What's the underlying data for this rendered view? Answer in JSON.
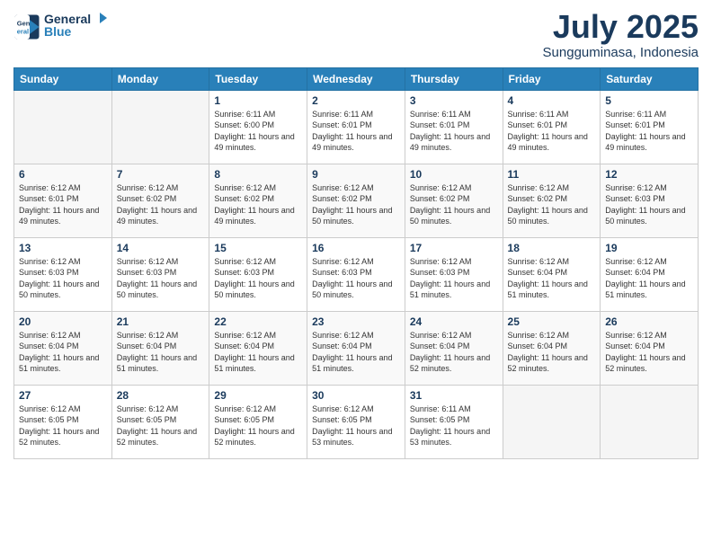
{
  "header": {
    "logo_line1": "General",
    "logo_line2": "Blue",
    "month": "July 2025",
    "location": "Sungguminasa, Indonesia"
  },
  "days_of_week": [
    "Sunday",
    "Monday",
    "Tuesday",
    "Wednesday",
    "Thursday",
    "Friday",
    "Saturday"
  ],
  "weeks": [
    [
      {
        "day": "",
        "info": ""
      },
      {
        "day": "",
        "info": ""
      },
      {
        "day": "1",
        "info": "Sunrise: 6:11 AM\nSunset: 6:00 PM\nDaylight: 11 hours\nand 49 minutes."
      },
      {
        "day": "2",
        "info": "Sunrise: 6:11 AM\nSunset: 6:01 PM\nDaylight: 11 hours\nand 49 minutes."
      },
      {
        "day": "3",
        "info": "Sunrise: 6:11 AM\nSunset: 6:01 PM\nDaylight: 11 hours\nand 49 minutes."
      },
      {
        "day": "4",
        "info": "Sunrise: 6:11 AM\nSunset: 6:01 PM\nDaylight: 11 hours\nand 49 minutes."
      },
      {
        "day": "5",
        "info": "Sunrise: 6:11 AM\nSunset: 6:01 PM\nDaylight: 11 hours\nand 49 minutes."
      }
    ],
    [
      {
        "day": "6",
        "info": "Sunrise: 6:12 AM\nSunset: 6:01 PM\nDaylight: 11 hours\nand 49 minutes."
      },
      {
        "day": "7",
        "info": "Sunrise: 6:12 AM\nSunset: 6:02 PM\nDaylight: 11 hours\nand 49 minutes."
      },
      {
        "day": "8",
        "info": "Sunrise: 6:12 AM\nSunset: 6:02 PM\nDaylight: 11 hours\nand 49 minutes."
      },
      {
        "day": "9",
        "info": "Sunrise: 6:12 AM\nSunset: 6:02 PM\nDaylight: 11 hours\nand 50 minutes."
      },
      {
        "day": "10",
        "info": "Sunrise: 6:12 AM\nSunset: 6:02 PM\nDaylight: 11 hours\nand 50 minutes."
      },
      {
        "day": "11",
        "info": "Sunrise: 6:12 AM\nSunset: 6:02 PM\nDaylight: 11 hours\nand 50 minutes."
      },
      {
        "day": "12",
        "info": "Sunrise: 6:12 AM\nSunset: 6:03 PM\nDaylight: 11 hours\nand 50 minutes."
      }
    ],
    [
      {
        "day": "13",
        "info": "Sunrise: 6:12 AM\nSunset: 6:03 PM\nDaylight: 11 hours\nand 50 minutes."
      },
      {
        "day": "14",
        "info": "Sunrise: 6:12 AM\nSunset: 6:03 PM\nDaylight: 11 hours\nand 50 minutes."
      },
      {
        "day": "15",
        "info": "Sunrise: 6:12 AM\nSunset: 6:03 PM\nDaylight: 11 hours\nand 50 minutes."
      },
      {
        "day": "16",
        "info": "Sunrise: 6:12 AM\nSunset: 6:03 PM\nDaylight: 11 hours\nand 50 minutes."
      },
      {
        "day": "17",
        "info": "Sunrise: 6:12 AM\nSunset: 6:03 PM\nDaylight: 11 hours\nand 51 minutes."
      },
      {
        "day": "18",
        "info": "Sunrise: 6:12 AM\nSunset: 6:04 PM\nDaylight: 11 hours\nand 51 minutes."
      },
      {
        "day": "19",
        "info": "Sunrise: 6:12 AM\nSunset: 6:04 PM\nDaylight: 11 hours\nand 51 minutes."
      }
    ],
    [
      {
        "day": "20",
        "info": "Sunrise: 6:12 AM\nSunset: 6:04 PM\nDaylight: 11 hours\nand 51 minutes."
      },
      {
        "day": "21",
        "info": "Sunrise: 6:12 AM\nSunset: 6:04 PM\nDaylight: 11 hours\nand 51 minutes."
      },
      {
        "day": "22",
        "info": "Sunrise: 6:12 AM\nSunset: 6:04 PM\nDaylight: 11 hours\nand 51 minutes."
      },
      {
        "day": "23",
        "info": "Sunrise: 6:12 AM\nSunset: 6:04 PM\nDaylight: 11 hours\nand 51 minutes."
      },
      {
        "day": "24",
        "info": "Sunrise: 6:12 AM\nSunset: 6:04 PM\nDaylight: 11 hours\nand 52 minutes."
      },
      {
        "day": "25",
        "info": "Sunrise: 6:12 AM\nSunset: 6:04 PM\nDaylight: 11 hours\nand 52 minutes."
      },
      {
        "day": "26",
        "info": "Sunrise: 6:12 AM\nSunset: 6:04 PM\nDaylight: 11 hours\nand 52 minutes."
      }
    ],
    [
      {
        "day": "27",
        "info": "Sunrise: 6:12 AM\nSunset: 6:05 PM\nDaylight: 11 hours\nand 52 minutes."
      },
      {
        "day": "28",
        "info": "Sunrise: 6:12 AM\nSunset: 6:05 PM\nDaylight: 11 hours\nand 52 minutes."
      },
      {
        "day": "29",
        "info": "Sunrise: 6:12 AM\nSunset: 6:05 PM\nDaylight: 11 hours\nand 52 minutes."
      },
      {
        "day": "30",
        "info": "Sunrise: 6:12 AM\nSunset: 6:05 PM\nDaylight: 11 hours\nand 53 minutes."
      },
      {
        "day": "31",
        "info": "Sunrise: 6:11 AM\nSunset: 6:05 PM\nDaylight: 11 hours\nand 53 minutes."
      },
      {
        "day": "",
        "info": ""
      },
      {
        "day": "",
        "info": ""
      }
    ]
  ]
}
